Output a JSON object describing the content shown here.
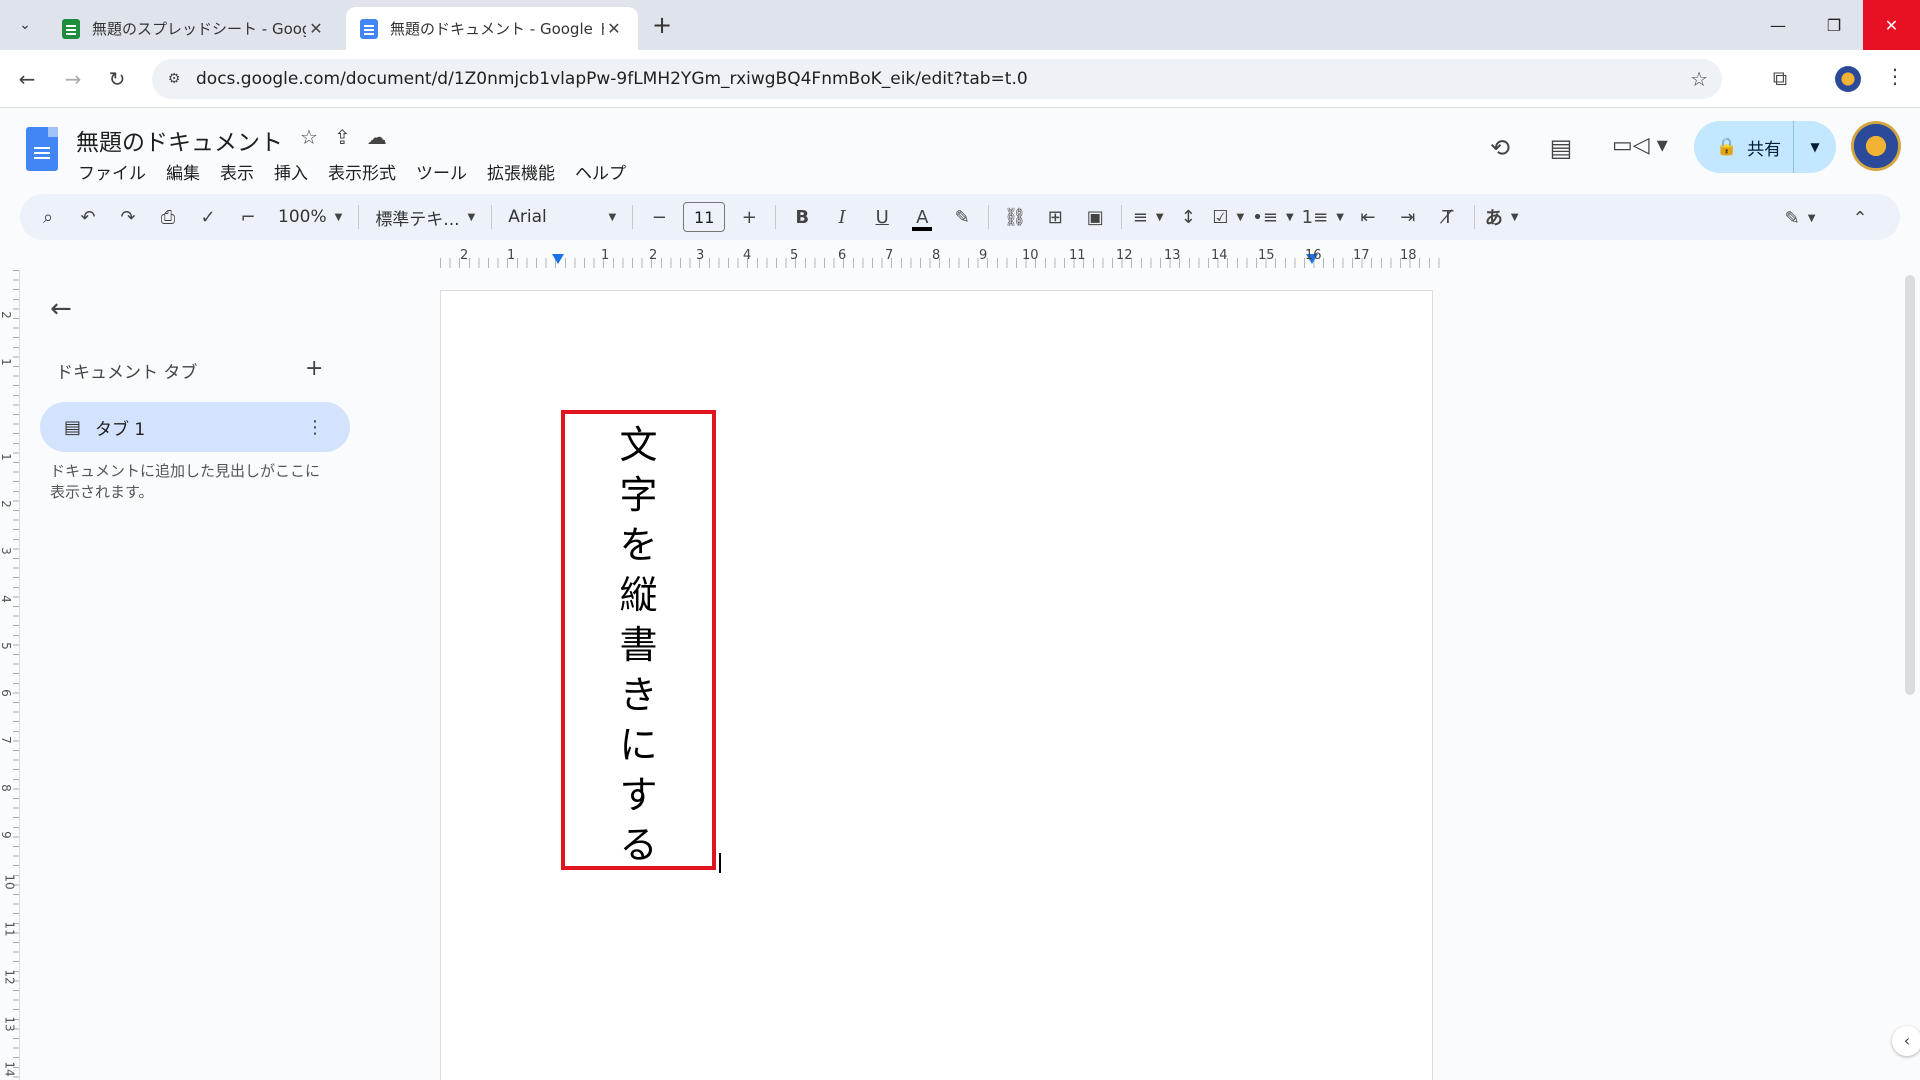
{
  "browser": {
    "tabs": [
      {
        "title": "無題のスプレッドシート - Google ス",
        "active": false,
        "favicon": "sheets-icon"
      },
      {
        "title": "無題のドキュメント - Google ドキュ",
        "active": true,
        "favicon": "docs-icon"
      }
    ],
    "url": "docs.google.com/document/d/1Z0nmjcb1vlapPw-9fLMH2YGm_rxiwgBQ4FnmBoK_eik/edit?tab=t.0"
  },
  "docs": {
    "title": "無題のドキュメント",
    "menu": [
      "ファイル",
      "編集",
      "表示",
      "挿入",
      "表示形式",
      "ツール",
      "拡張機能",
      "ヘルプ"
    ],
    "share_label": "共有"
  },
  "format_toolbar": {
    "zoom": "100%",
    "style": "標準テキ...",
    "font": "Arial",
    "font_size": "11",
    "input_mode": "あ"
  },
  "ruler": {
    "h_numbers": [
      "2",
      "1",
      "1",
      "2",
      "3",
      "4",
      "5",
      "6",
      "7",
      "8",
      "9",
      "10",
      "11",
      "12",
      "13",
      "14",
      "15",
      "16",
      "17",
      "18"
    ],
    "v_numbers": [
      "2",
      "1",
      "1",
      "2",
      "3",
      "4",
      "5",
      "6",
      "7",
      "8",
      "9",
      "10",
      "11",
      "12",
      "13",
      "14"
    ]
  },
  "sidebar": {
    "heading": "ドキュメント タブ",
    "tab_label": "タブ 1",
    "hint": "ドキュメントに追加した見出しがここに表示されます。"
  },
  "document": {
    "vertical_text": [
      "文",
      "字",
      "を",
      "縦",
      "書",
      "き",
      "に",
      "す",
      "る"
    ],
    "highlight_color": "#e0141e"
  },
  "colors": {
    "accent": "#1a73e8",
    "share_bg": "#c2e7ff",
    "tab_active_bg": "#d3e3fd"
  }
}
